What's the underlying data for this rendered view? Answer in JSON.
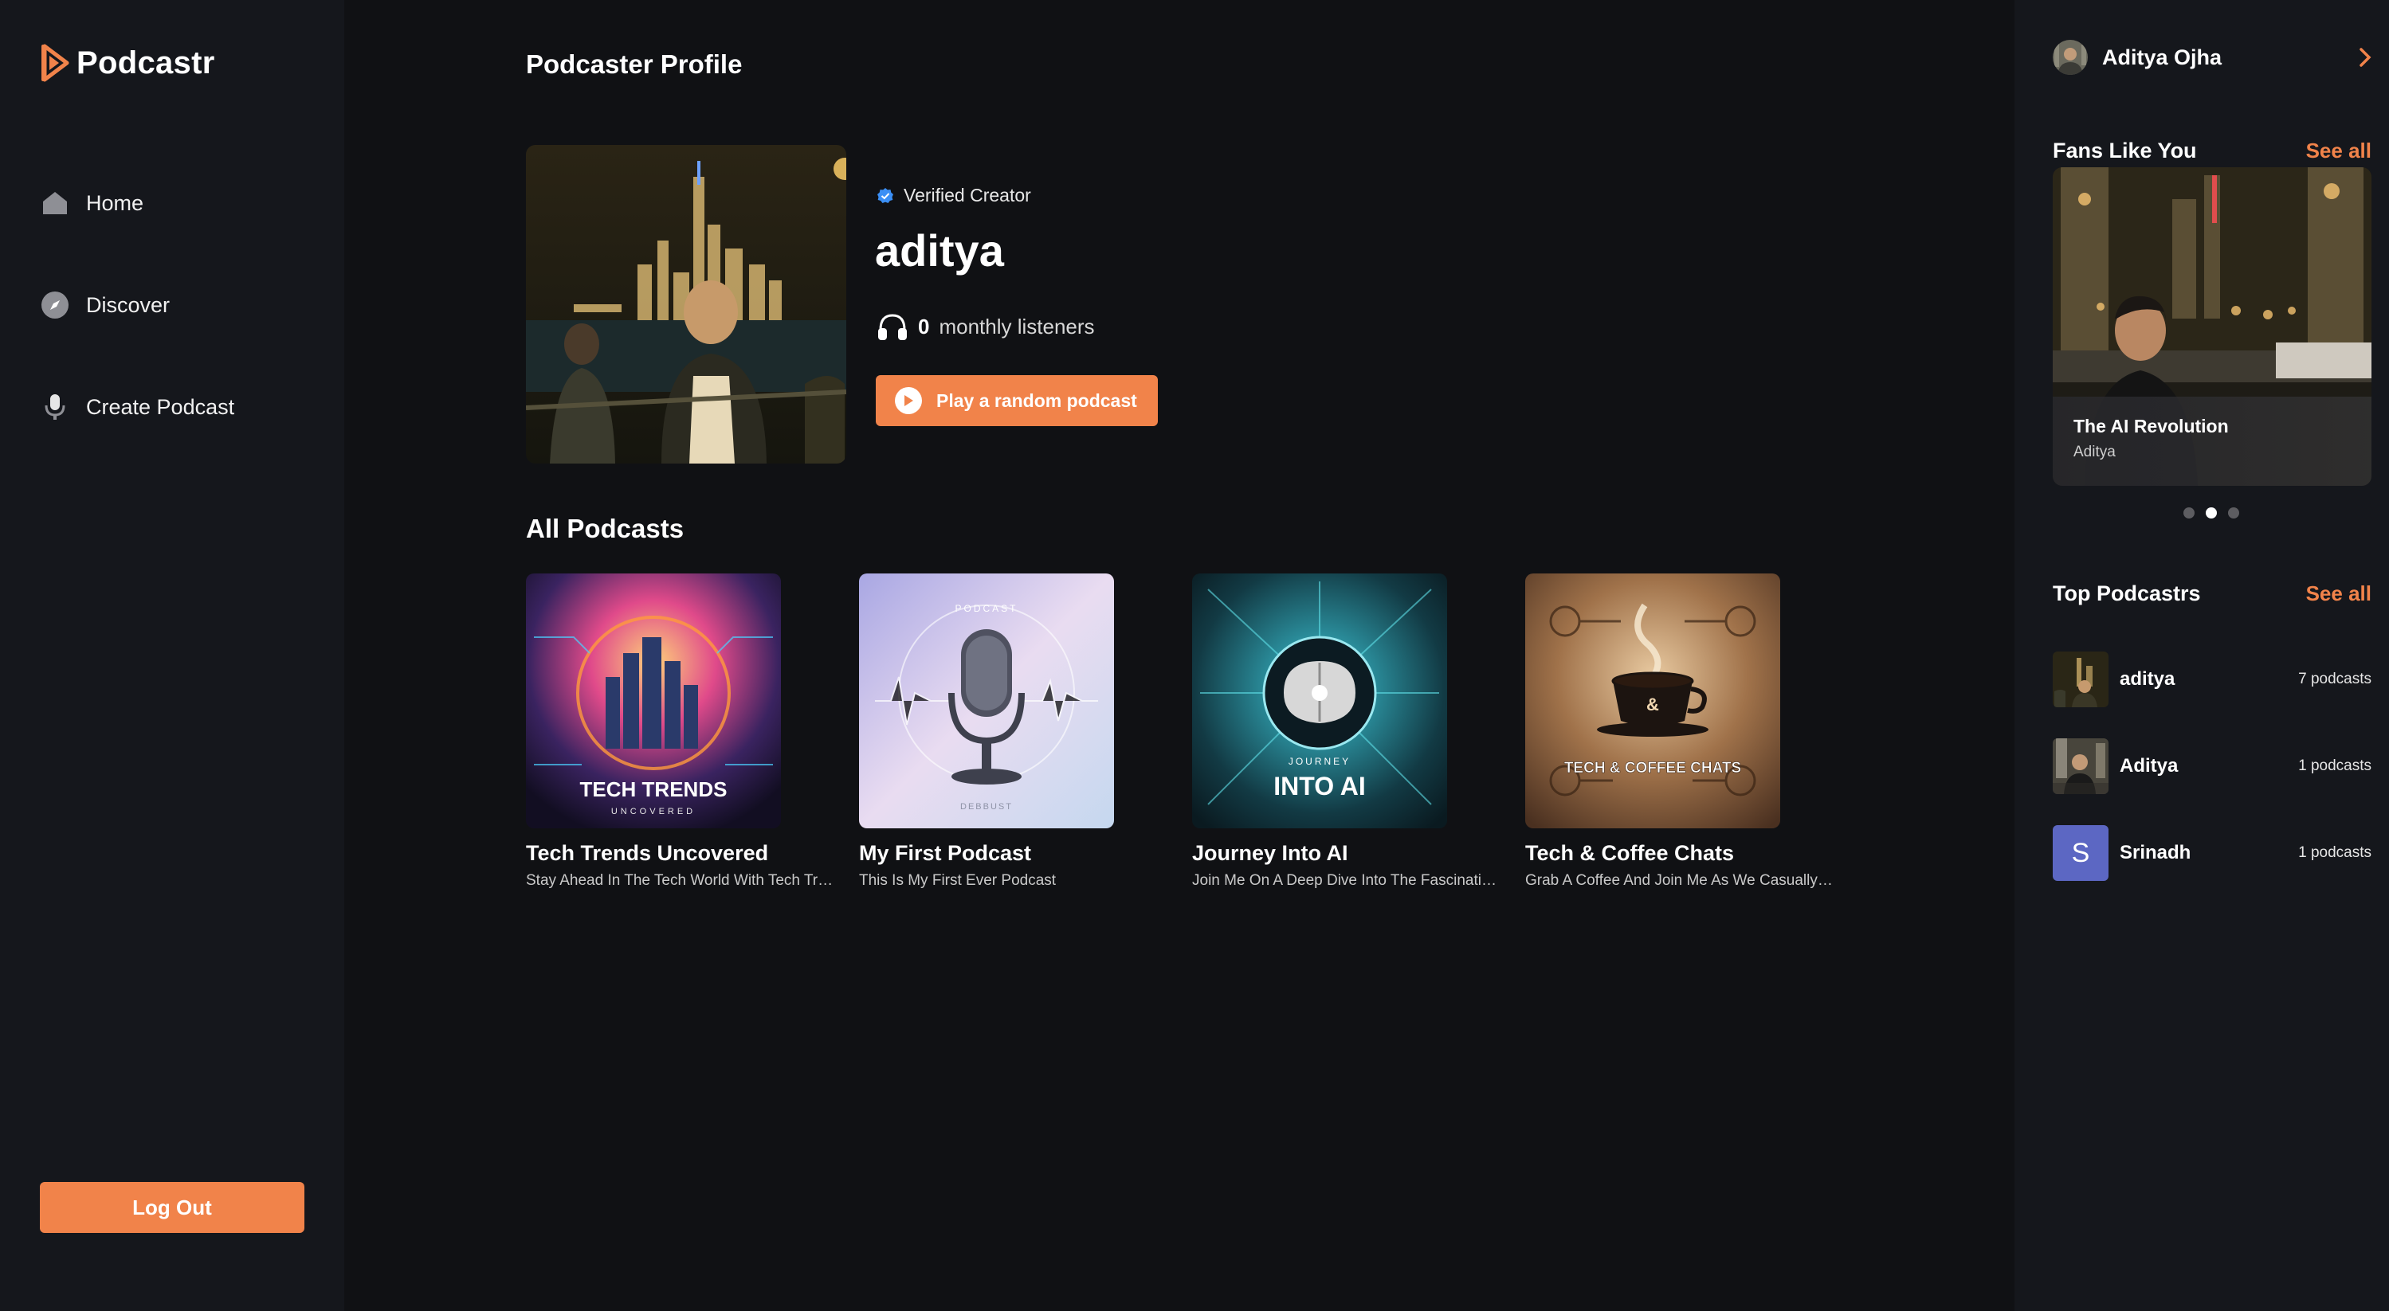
{
  "brand": {
    "name": "Podcastr",
    "accent": "#f1834a"
  },
  "nav": [
    {
      "label": "Home",
      "icon": "home-icon"
    },
    {
      "label": "Discover",
      "icon": "compass-icon"
    },
    {
      "label": "Create Podcast",
      "icon": "microphone-icon"
    }
  ],
  "logout_label": "Log Out",
  "profile": {
    "page_title": "Podcaster Profile",
    "verified_label": "Verified Creator",
    "name": "aditya",
    "listener_count": "0",
    "listener_label": "monthly listeners",
    "play_button": "Play a random podcast"
  },
  "all_podcasts": {
    "title": "All Podcasts",
    "items": [
      {
        "title": "Tech Trends Uncovered",
        "description": "Stay Ahead In The Tech World With Tech Trends Uncovered",
        "cover_text": "TECH TRENDS",
        "cover_subtext": "UNCOVERED"
      },
      {
        "title": "My First Podcast",
        "description": "This Is My First Ever Podcast",
        "cover_text": "PODCAST",
        "cover_subtext": "DEBBUST"
      },
      {
        "title": "Journey Into AI",
        "description": "Join Me On A Deep Dive Into The Fascinating World Of AI",
        "cover_text": "INTO AI",
        "cover_subtext": "JOURNEY"
      },
      {
        "title": "Tech & Coffee Chats",
        "description": "Grab A Coffee And Join Me As We Casually Chat About Tech",
        "cover_text": "TECH & COFFEE CHATS",
        "cover_subtext": "&"
      }
    ]
  },
  "right_sidebar": {
    "user_name": "Aditya Ojha",
    "fans": {
      "title": "Fans Like You",
      "see_all": "See all",
      "card_title": "The AI Revolution",
      "card_subtitle": "Aditya",
      "slide_count": 3,
      "active_slide": 2
    },
    "top": {
      "title": "Top Podcastrs",
      "see_all": "See all",
      "items": [
        {
          "name": "aditya",
          "count": "7 podcasts",
          "avatar": "photo"
        },
        {
          "name": "Aditya",
          "count": "1 podcasts",
          "avatar": "photo"
        },
        {
          "name": "Srinadh",
          "count": "1 podcasts",
          "avatar": "S"
        }
      ]
    }
  }
}
